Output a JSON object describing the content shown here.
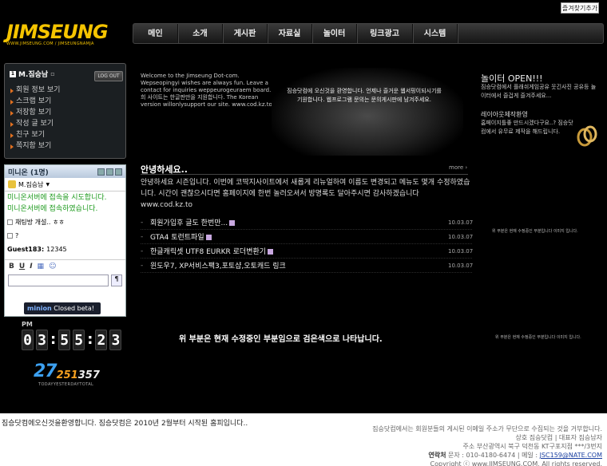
{
  "fav_button": "즐겨찾기추가",
  "logo": {
    "word": "JIMSEUNG",
    "sub": "WWW.JIMSEUNG.COM / JIMSEUNGNAMJA"
  },
  "nav": [
    "메인",
    "소개",
    "게시판",
    "자료실",
    "놀이터",
    "링크광고",
    "시스템"
  ],
  "login": {
    "user": "M.짐승남",
    "logout": "LOG OUT",
    "menu": [
      "회원 정보 보기",
      "스크랩 보기",
      "저장함 보기",
      "작성 글 보기",
      "친구 보기",
      "쪽지함 보기"
    ]
  },
  "minion": {
    "title": "미니온 (1명)",
    "nick": "M.짐승남",
    "msg1": "미니온서버에 접속을 시도합니다.",
    "msg2": "미니온서버에 접속하였습니다.",
    "chat": [
      {
        "text": "채팅방 개설.. ㅎㅎ"
      },
      {
        "text": "?"
      }
    ],
    "guest_name": "Guest183:",
    "guest_msg": "12345",
    "tools": [
      "B",
      "U",
      "I"
    ],
    "send": "¶",
    "badge_brand": "minion",
    "badge_text": "Closed beta!"
  },
  "clock": {
    "ampm": "PM",
    "h": [
      "0",
      "3"
    ],
    "m": [
      "5",
      "5"
    ],
    "s": [
      "2",
      "3"
    ]
  },
  "counter": {
    "today": "27",
    "yesterday": "251",
    "total": "357",
    "labels": "TODAYYESTERDAYTOTAL"
  },
  "welcome_text": "Welcome to the Jimseung Dot-com. Wepseopingyi wishes are always fun. Leave a contact for inquiries weppeurogeuraem board. 저희 사이트는 한글판만을 지원합니다. The Korean version willonlysupport our site. www.cod.kz.to",
  "banner_text": "짐승닷컴에 오신것을 환영합니다. 언제나 즐거운 웹서핑이되시기를 기원합니다. 웹프로그램 문의는 문의게시판에 남겨주세요.",
  "side": {
    "title": "놀이터 OPEN!!!",
    "text1": "짐승닷컴에서 플래쉬게임공유 웃긴사진 공유등 놀이터에서 즐겁게 즐겨주세요...",
    "sub": "레이아웃제작환영",
    "text2": "홈페이지틀좋 만드시겠다구요..? 짐승닷컴에서 유무료 제작을 해드립니다.",
    "note1": "위 부분은 현재 수정중인 부분입니다 이미지 입니다.",
    "note2": "위 부분은 현재 수정중인 부분입니다 이미지 입니다."
  },
  "hello": {
    "title": "안녕하세요..",
    "more": "more",
    "body": "안녕하세요 시즌입니다. 이번에 코딱지사이트에서 새롭게 리뉴얼하여 이름도 변경되고 메뉴도 몇개 수정하였습니다. 시간이 괜찮으시다면 홈페이지에 한번 놀러오셔서 방명록도 달아주시면 감사하겠습니다 www.cod.kz.to"
  },
  "news": [
    {
      "title": "회원가입후 글도 한번만...",
      "date": "10.03.07",
      "new": true
    },
    {
      "title": "GTA4 토런트파일",
      "date": "10.03.07",
      "new": true
    },
    {
      "title": "한글캐릭셋 UTF8 EURKR 로더변환기",
      "date": "10.03.07",
      "new": true
    },
    {
      "title": "윈도우7, XP서비스팩3,포토샵,오토캐드 링크",
      "date": "10.03.07",
      "new": false
    }
  ],
  "notice": "위 부분은 현재 수정중인 부분임으로 검은색으로 나타납니다.",
  "footer": {
    "msg": "짐승닷컴에오신것을환영합니다. 짐승닷컴은 2010년 2월부터 시작된 홈피입니다..",
    "line1": "짐승닷컴에서는 회원분들의 게시된 이메일 주소가 무단으로 수집되는 것을 거부합니다.",
    "line2": "상호 짐승닷컴 | 대표자 짐승남자",
    "line3": "주소 부산광역시 북구 덕천동 KT구포지점 ***/3번지",
    "line4_label": "연락처",
    "line4": "문자 : 010-4180-6474 | 메일 :",
    "email": "JSC159@NATE.COM",
    "line5": "Copyright ⓒ www.JIMSEUNG.COM, All rights reserved."
  }
}
